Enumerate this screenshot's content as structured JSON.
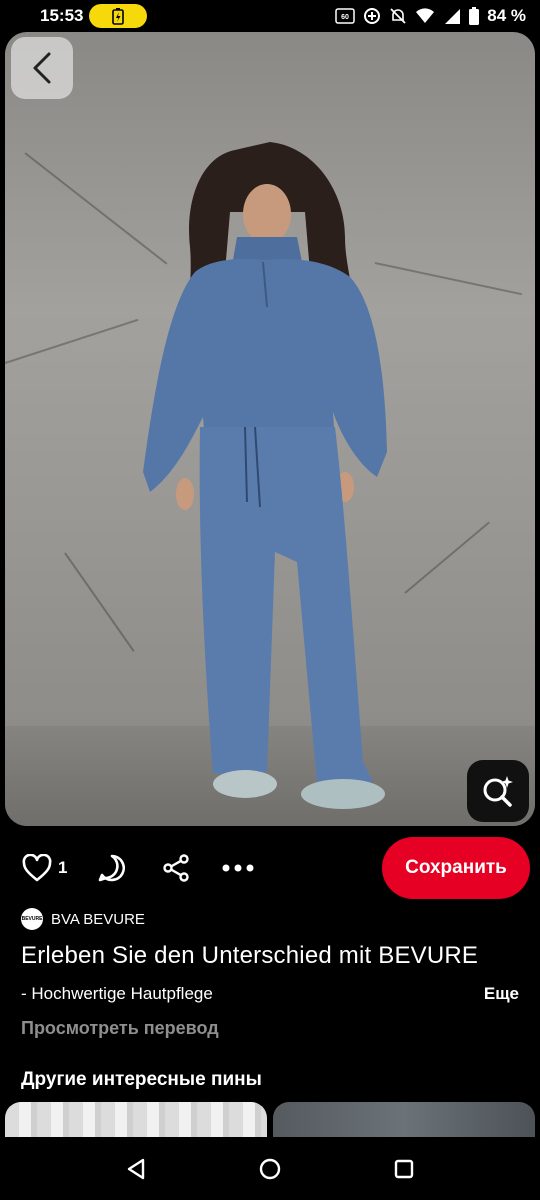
{
  "status_bar": {
    "time": "15:53",
    "battery_percent": "84 %",
    "icons": [
      "battery-saver-icon",
      "hd-icon",
      "data-saver-icon",
      "mute-icon",
      "wifi-icon",
      "signal-icon",
      "battery-icon"
    ]
  },
  "pin": {
    "like_count": "1",
    "save_label": "Сохранить",
    "author_name": "BVA BEVURE",
    "avatar_text": "BEVURE",
    "title": "Erleben Sie den Unterschied mit BEVURE",
    "description": "- Hochwertige Hautpflege",
    "more_label": "Еще",
    "translate_label": "Просмотреть перевод"
  },
  "related": {
    "section_title": "Другие интересные пины"
  },
  "colors": {
    "save_button": "#e60023",
    "background": "#000000",
    "muted_text": "#8e8e8e",
    "battery_pill": "#f5d90a"
  }
}
